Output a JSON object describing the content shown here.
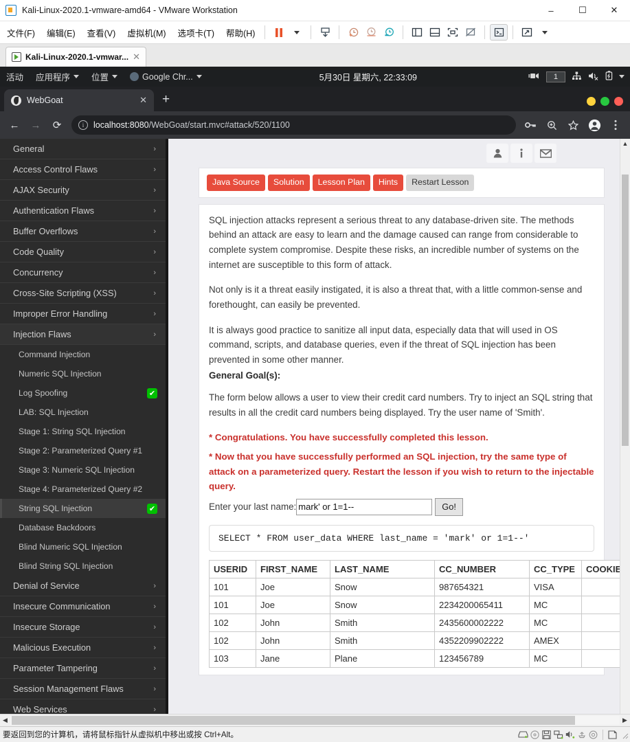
{
  "vmware": {
    "title": "Kali-Linux-2020.1-vmware-amd64 - VMware Workstation",
    "window_buttons": {
      "minimize": "–",
      "maximize": "☐",
      "close": "✕"
    },
    "menus": [
      "文件(F)",
      "编辑(E)",
      "查看(V)",
      "虚拟机(M)",
      "选项卡(T)",
      "帮助(H)"
    ],
    "toolbar_icons": [
      "pause-icon",
      "dropdown-caret-icon",
      "send-ctrl-alt-del-icon",
      "snapshot-take-icon",
      "snapshot-revert-icon",
      "snapshot-manager-icon",
      "show-sidebar-icon",
      "show-bottom-panel-icon",
      "fit-guest-icon",
      "fit-window-icon",
      "console-view-icon",
      "fullscreen-icon",
      "fullscreen-caret-icon"
    ],
    "tab": {
      "label": "Kali-Linux-2020.1-vmwar...",
      "close": "✕"
    },
    "status": {
      "message": "要返回到您的计算机，请将鼠标指针从虚拟机中移出或按 Ctrl+Alt。",
      "device_icons": [
        "harddisk-icon",
        "cdrom-icon",
        "floppy-icon",
        "network-icon",
        "sound-icon",
        "usb-icon",
        "printer-icon",
        "display-icon"
      ]
    }
  },
  "gnome": {
    "activities": "活动",
    "applications": "应用程序",
    "places": "位置",
    "current_app": "Google Chr...",
    "clock": "5月30日 星期六, 22:33:09",
    "workspace": "1",
    "right_icons": [
      "screencast-icon",
      "network-wired-icon",
      "volume-muted-icon",
      "battery-charging-icon",
      "system-menu-caret-icon"
    ]
  },
  "chrome": {
    "tab_title": "WebGoat",
    "tab_close": "✕",
    "new_tab": "+",
    "window_buttons": {
      "minimize_color": "#ffd33d",
      "maximize_color": "#28c840",
      "close_color": "#ff5f57"
    },
    "nav": {
      "back": "←",
      "forward": "→",
      "reload": "⟳"
    },
    "url_prefix": "localhost:8080",
    "url_rest": "/WebGoat/start.mvc#attack/520/1100",
    "toolbar_icons": [
      "key-icon",
      "zoom-icon",
      "bookmark-star-icon",
      "profile-avatar-icon",
      "more-menu-icon"
    ]
  },
  "sidebar": {
    "categories": [
      {
        "label": "General"
      },
      {
        "label": "Access Control Flaws"
      },
      {
        "label": "AJAX Security"
      },
      {
        "label": "Authentication Flaws"
      },
      {
        "label": "Buffer Overflows"
      },
      {
        "label": "Code Quality"
      },
      {
        "label": "Concurrency"
      },
      {
        "label": "Cross-Site Scripting (XSS)"
      },
      {
        "label": "Improper Error Handling"
      },
      {
        "label": "Injection Flaws"
      }
    ],
    "lessons": [
      {
        "label": "Command Injection",
        "done": false
      },
      {
        "label": "Numeric SQL Injection",
        "done": false
      },
      {
        "label": "Log Spoofing",
        "done": true
      },
      {
        "label": "LAB: SQL Injection",
        "done": false
      },
      {
        "label": "Stage 1: String SQL Injection",
        "done": false
      },
      {
        "label": "Stage 2: Parameterized Query #1",
        "done": false
      },
      {
        "label": "Stage 3: Numeric SQL Injection",
        "done": false
      },
      {
        "label": "Stage 4: Parameterized Query #2",
        "done": false
      },
      {
        "label": "String SQL Injection",
        "done": true,
        "selected": true
      },
      {
        "label": "Database Backdoors",
        "done": false
      },
      {
        "label": "Blind Numeric SQL Injection",
        "done": false
      },
      {
        "label": "Blind String SQL Injection",
        "done": false
      }
    ],
    "categories_after": [
      {
        "label": "Denial of Service"
      },
      {
        "label": "Insecure Communication"
      },
      {
        "label": "Insecure Storage"
      },
      {
        "label": "Malicious Execution"
      },
      {
        "label": "Parameter Tampering"
      },
      {
        "label": "Session Management Flaws"
      },
      {
        "label": "Web Services"
      }
    ],
    "chevron": "›",
    "check_glyph": "✔"
  },
  "lesson": {
    "header_icons": [
      "user-icon",
      "info-icon",
      "mail-icon"
    ],
    "buttons": [
      {
        "label": "Java Source",
        "style": "red"
      },
      {
        "label": "Solution",
        "style": "red"
      },
      {
        "label": "Lesson Plan",
        "style": "red"
      },
      {
        "label": "Hints",
        "style": "red"
      },
      {
        "label": "Restart Lesson",
        "style": "gray"
      }
    ],
    "paragraph1": "SQL injection attacks represent a serious threat to any database-driven site. The methods behind an attack are easy to learn and the damage caused can range from considerable to complete system compromise. Despite these risks, an incredible number of systems on the internet are susceptible to this form of attack.",
    "paragraph2": "Not only is it a threat easily instigated, it is also a threat that, with a little common-sense and forethought, can easily be prevented.",
    "paragraph3": "It is always good practice to sanitize all input data, especially data that will used in OS command, scripts, and database queries, even if the threat of SQL injection has been prevented in some other manner.",
    "goal_heading": "General Goal(s):",
    "goal_text": "The form below allows a user to view their credit card numbers. Try to inject an SQL string that results in all the credit card numbers being displayed. Try the user name of 'Smith'.",
    "congrats_line1": "* Congratulations. You have successfully completed this lesson.",
    "congrats_line2": "* Now that you have successfully performed an SQL injection, try the same type of attack on a parameterized query. Restart the lesson if you wish to return to the injectable query.",
    "form": {
      "label": "Enter your last name:",
      "value": "mark' or 1=1--",
      "placeholder": "",
      "submit": "Go!"
    },
    "sql_query": "SELECT * FROM user_data WHERE last_name = 'mark' or 1=1--'",
    "table": {
      "headers": [
        "USERID",
        "FIRST_NAME",
        "LAST_NAME",
        "CC_NUMBER",
        "CC_TYPE",
        "COOKIE"
      ],
      "rows": [
        [
          "101",
          "Joe",
          "Snow",
          "987654321",
          "VISA",
          ""
        ],
        [
          "101",
          "Joe",
          "Snow",
          "2234200065411",
          "MC",
          ""
        ],
        [
          "102",
          "John",
          "Smith",
          "2435600002222",
          "MC",
          ""
        ],
        [
          "102",
          "John",
          "Smith",
          "4352209902222",
          "AMEX",
          ""
        ],
        [
          "103",
          "Jane",
          "Plane",
          "123456789",
          "MC",
          ""
        ]
      ]
    }
  },
  "colors": {
    "accent_red": "#e74c3c",
    "congrats_red": "#c9302c",
    "sidebar_bg": "#2c2c2c",
    "success_green": "#00c000"
  }
}
